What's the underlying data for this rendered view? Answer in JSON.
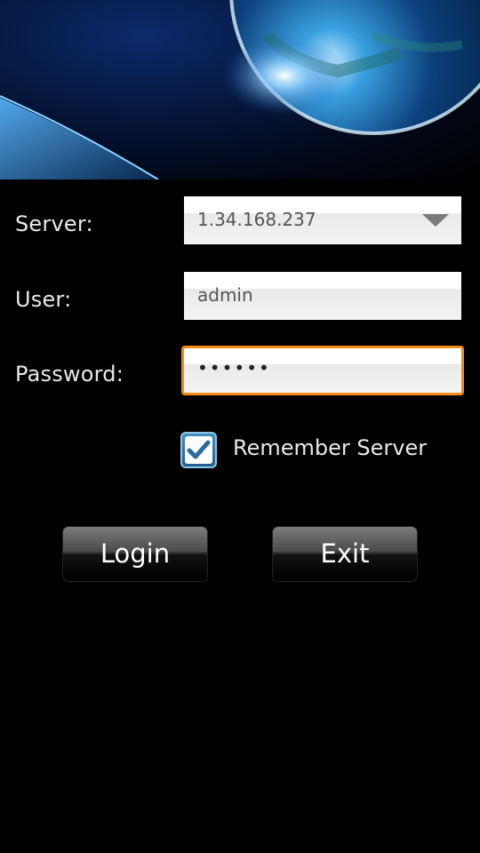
{
  "form": {
    "server_label": "Server:",
    "server_value": "1.34.168.237",
    "user_label": "User:",
    "user_value": "admin",
    "password_label": "Password:",
    "password_value": "••••••",
    "remember_label": "Remember Server",
    "remember_checked": true
  },
  "buttons": {
    "login": "Login",
    "exit": "Exit"
  },
  "colors": {
    "focus_border": "#f28a17",
    "background": "#000000",
    "checkbox": "#2f79ad"
  },
  "icons": {
    "dropdown": "chevron-down-icon",
    "check": "checkmark-icon",
    "banner": "planet-space-image"
  }
}
